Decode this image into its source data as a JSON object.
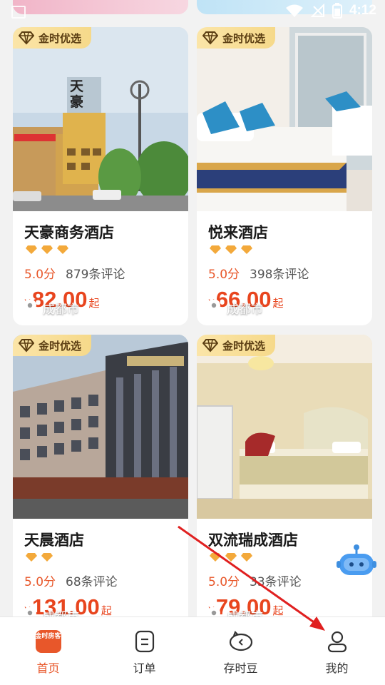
{
  "status_bar": {
    "time": "4:12"
  },
  "hotels": [
    {
      "badge": "金时优选",
      "location": "成都市",
      "name": "天豪商务酒店",
      "diamonds": 3,
      "score": "5.0分",
      "reviews": "879条评论",
      "currency": "¥",
      "price": "82.00",
      "suffix": "起",
      "photo_sign": "天豪"
    },
    {
      "badge": "金时优选",
      "location": "成都市",
      "name": "悦来酒店",
      "diamonds": 3,
      "score": "5.0分",
      "reviews": "398条评论",
      "currency": "¥",
      "price": "66.00",
      "suffix": "起"
    },
    {
      "badge": "金时优选",
      "location": "成都市",
      "name": "天晨酒店",
      "diamonds": 2,
      "score": "5.0分",
      "reviews": "68条评论",
      "currency": "¥",
      "price": "131.00",
      "suffix": "起"
    },
    {
      "badge": "金时优选",
      "location": "成都市",
      "name": "双流瑞成酒店",
      "diamonds": 3,
      "score": "5.0分",
      "reviews": "33条评论",
      "currency": "¥",
      "price": "79.00",
      "suffix": "起"
    }
  ],
  "tabbar": {
    "logo_text": "金时房客",
    "items": [
      {
        "label": "首页",
        "icon": "home-logo-icon",
        "active": true
      },
      {
        "label": "订单",
        "icon": "order-list-icon",
        "active": false
      },
      {
        "label": "存时豆",
        "icon": "piggy-bank-icon",
        "active": false
      },
      {
        "label": "我的",
        "icon": "user-profile-icon",
        "active": false
      }
    ]
  },
  "colors": {
    "accent": "#e8572a",
    "price": "#e8451e",
    "badge_bg": "#f6d98a",
    "diamond": "#f3a93b"
  }
}
